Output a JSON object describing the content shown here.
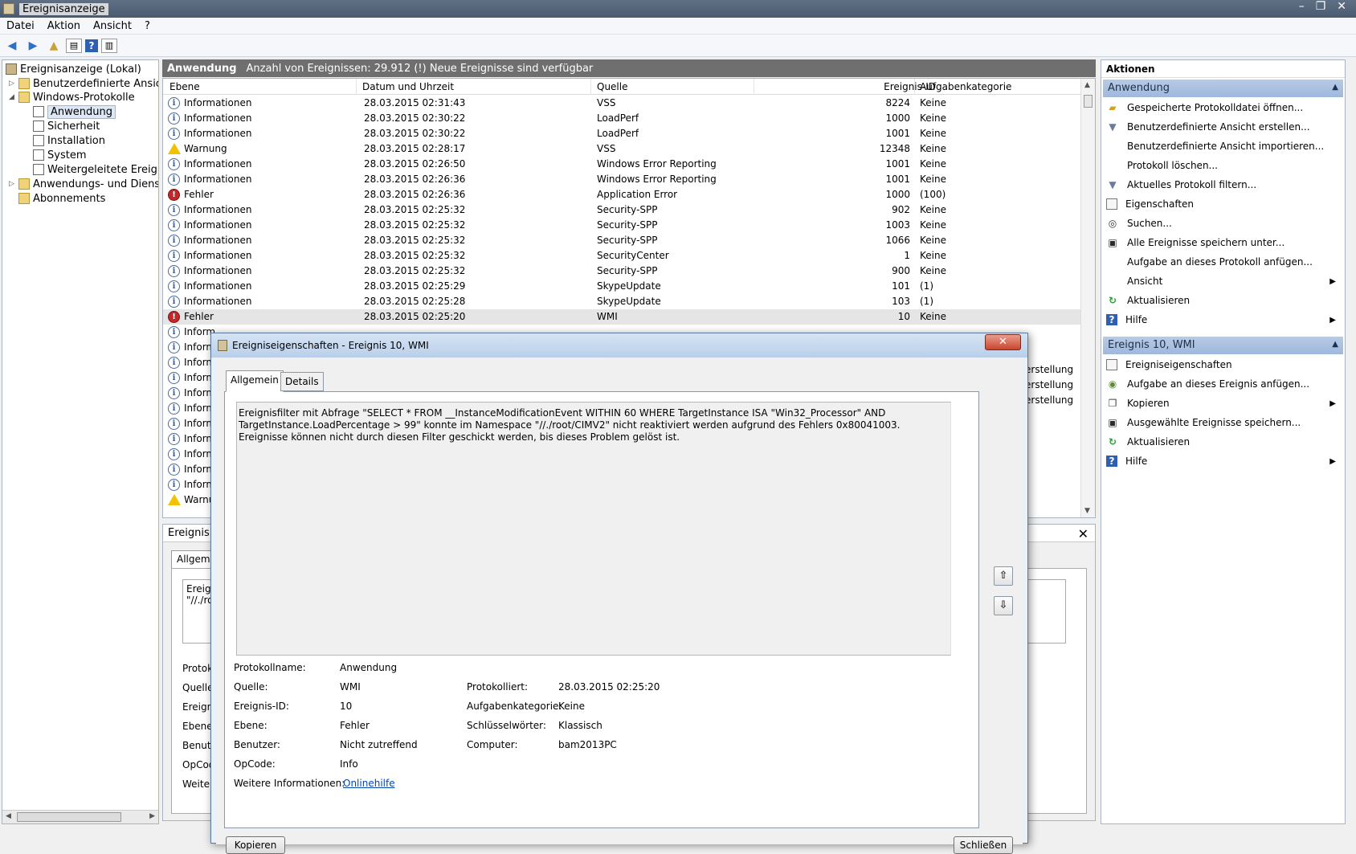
{
  "window": {
    "title": "Ereignisanzeige",
    "controls": [
      "–",
      "❐",
      "✕"
    ]
  },
  "menu": [
    "Datei",
    "Aktion",
    "Ansicht",
    "?"
  ],
  "tree": {
    "root": "Ereignisanzeige (Lokal)",
    "custom_views": "Benutzerdefinierte Ansichten",
    "windows_logs": "Windows-Protokolle",
    "logs": [
      "Anwendung",
      "Sicherheit",
      "Installation",
      "System",
      "Weitergeleitete Ereignisse"
    ],
    "app_services": "Anwendungs- und Dienstprotokolle",
    "subscriptions": "Abonnements"
  },
  "center": {
    "log_name": "Anwendung",
    "info": "Anzahl von Ereignissen: 29.912 (!) Neue Ereignisse sind verfügbar",
    "columns": {
      "level": "Ebene",
      "date": "Datum und Uhrzeit",
      "source": "Quelle",
      "id": "Ereignis-ID",
      "category": "Aufgabenkategorie"
    },
    "rows": [
      {
        "level": "Informationen",
        "type": "info",
        "date": "28.03.2015 02:31:43",
        "source": "VSS",
        "id": "8224",
        "category": "Keine"
      },
      {
        "level": "Informationen",
        "type": "info",
        "date": "28.03.2015 02:30:22",
        "source": "LoadPerf",
        "id": "1000",
        "category": "Keine"
      },
      {
        "level": "Informationen",
        "type": "info",
        "date": "28.03.2015 02:30:22",
        "source": "LoadPerf",
        "id": "1001",
        "category": "Keine"
      },
      {
        "level": "Warnung",
        "type": "warn",
        "date": "28.03.2015 02:28:17",
        "source": "VSS",
        "id": "12348",
        "category": "Keine"
      },
      {
        "level": "Informationen",
        "type": "info",
        "date": "28.03.2015 02:26:50",
        "source": "Windows Error Reporting",
        "id": "1001",
        "category": "Keine"
      },
      {
        "level": "Informationen",
        "type": "info",
        "date": "28.03.2015 02:26:36",
        "source": "Windows Error Reporting",
        "id": "1001",
        "category": "Keine"
      },
      {
        "level": "Fehler",
        "type": "err",
        "date": "28.03.2015 02:26:36",
        "source": "Application Error",
        "id": "1000",
        "category": "(100)"
      },
      {
        "level": "Informationen",
        "type": "info",
        "date": "28.03.2015 02:25:32",
        "source": "Security-SPP",
        "id": "902",
        "category": "Keine"
      },
      {
        "level": "Informationen",
        "type": "info",
        "date": "28.03.2015 02:25:32",
        "source": "Security-SPP",
        "id": "1003",
        "category": "Keine"
      },
      {
        "level": "Informationen",
        "type": "info",
        "date": "28.03.2015 02:25:32",
        "source": "Security-SPP",
        "id": "1066",
        "category": "Keine"
      },
      {
        "level": "Informationen",
        "type": "info",
        "date": "28.03.2015 02:25:32",
        "source": "SecurityCenter",
        "id": "1",
        "category": "Keine"
      },
      {
        "level": "Informationen",
        "type": "info",
        "date": "28.03.2015 02:25:32",
        "source": "Security-SPP",
        "id": "900",
        "category": "Keine"
      },
      {
        "level": "Informationen",
        "type": "info",
        "date": "28.03.2015 02:25:29",
        "source": "SkypeUpdate",
        "id": "101",
        "category": "(1)"
      },
      {
        "level": "Informationen",
        "type": "info",
        "date": "28.03.2015 02:25:28",
        "source": "SkypeUpdate",
        "id": "103",
        "category": "(1)"
      },
      {
        "level": "Fehler",
        "type": "err",
        "date": "28.03.2015 02:25:20",
        "source": "WMI",
        "id": "10",
        "category": "Keine"
      },
      {
        "level": "Inform",
        "type": "info",
        "date": "",
        "source": "",
        "id": "",
        "category": ""
      },
      {
        "level": "Inform",
        "type": "info",
        "date": "",
        "source": "",
        "id": "",
        "category": ""
      },
      {
        "level": "Inform",
        "type": "info",
        "date": "",
        "source": "",
        "id": "",
        "category": ""
      },
      {
        "level": "Inform",
        "type": "info",
        "date": "",
        "source": "",
        "id": "",
        "category": ""
      },
      {
        "level": "Inform",
        "type": "info",
        "date": "",
        "source": "",
        "id": "",
        "category": ""
      },
      {
        "level": "Inform",
        "type": "info",
        "date": "",
        "source": "",
        "id": "",
        "category": ""
      },
      {
        "level": "Inform",
        "type": "info",
        "date": "",
        "source": "",
        "id": "",
        "category": ""
      },
      {
        "level": "Inform",
        "type": "info",
        "date": "",
        "source": "",
        "id": "",
        "category": ""
      },
      {
        "level": "Inform",
        "type": "info",
        "date": "",
        "source": "",
        "id": "",
        "category": ""
      },
      {
        "level": "Inform",
        "type": "info",
        "date": "",
        "source": "",
        "id": "",
        "category": ""
      },
      {
        "level": "Inform",
        "type": "info",
        "date": "",
        "source": "",
        "id": "",
        "category": ""
      },
      {
        "level": "Warnu",
        "type": "warn",
        "date": "",
        "source": "",
        "id": "",
        "category": ""
      }
    ],
    "tail_text": "erstellung"
  },
  "preview": {
    "title": "Ereignis 1",
    "tab": "Allgeme",
    "text_line1": "Ereign",
    "text_line2": "\"//./ro",
    "labels": [
      "Protoko",
      "Quelle:",
      "Ereigni",
      "Ebene:",
      "Benutz",
      "OpCod",
      "Weitere"
    ]
  },
  "actions": {
    "header": "Aktionen",
    "section1": "Anwendung",
    "items1": [
      "Gespeicherte Protokolldatei öffnen...",
      "Benutzerdefinierte Ansicht erstellen...",
      "Benutzerdefinierte Ansicht importieren...",
      "Protokoll löschen...",
      "Aktuelles Protokoll filtern...",
      "Eigenschaften",
      "Suchen...",
      "Alle Ereignisse speichern unter...",
      "Aufgabe an dieses Protokoll anfügen...",
      "Ansicht",
      "Aktualisieren",
      "Hilfe"
    ],
    "section2": "Ereignis 10, WMI",
    "items2": [
      "Ereigniseigenschaften",
      "Aufgabe an dieses Ereignis anfügen...",
      "Kopieren",
      "Ausgewählte Ereignisse speichern...",
      "Aktualisieren",
      "Hilfe"
    ]
  },
  "dialog": {
    "title": "Ereigniseigenschaften - Ereignis 10, WMI",
    "close": "✕",
    "tabs": [
      "Allgemein",
      "Details"
    ],
    "description": "Ereignisfilter mit Abfrage \"SELECT * FROM __InstanceModificationEvent WITHIN 60 WHERE TargetInstance ISA \"Win32_Processor\" AND TargetInstance.LoadPercentage > 99\" konnte im Namespace \"//./root/CIMV2\" nicht reaktiviert werden aufgrund des Fehlers 0x80041003. Ereignisse können nicht durch diesen Filter geschickt werden, bis dieses Problem gelöst ist.",
    "fields": {
      "log_name_label": "Protokollname:",
      "log_name": "Anwendung",
      "source_label": "Quelle:",
      "source": "WMI",
      "logged_label": "Protokolliert:",
      "logged": "28.03.2015 02:25:20",
      "event_id_label": "Ereignis-ID:",
      "event_id": "10",
      "category_label": "Aufgabenkategorie:",
      "category": "Keine",
      "level_label": "Ebene:",
      "level": "Fehler",
      "keywords_label": "Schlüsselwörter:",
      "keywords": "Klassisch",
      "user_label": "Benutzer:",
      "user": "Nicht zutreffend",
      "computer_label": "Computer:",
      "computer": "bam2013PC",
      "opcode_label": "OpCode:",
      "opcode": "Info",
      "more_info_label": "Weitere Informationen:",
      "more_info_link": "Onlinehilfe"
    },
    "buttons": {
      "copy": "Kopieren",
      "close": "Schließen"
    }
  }
}
